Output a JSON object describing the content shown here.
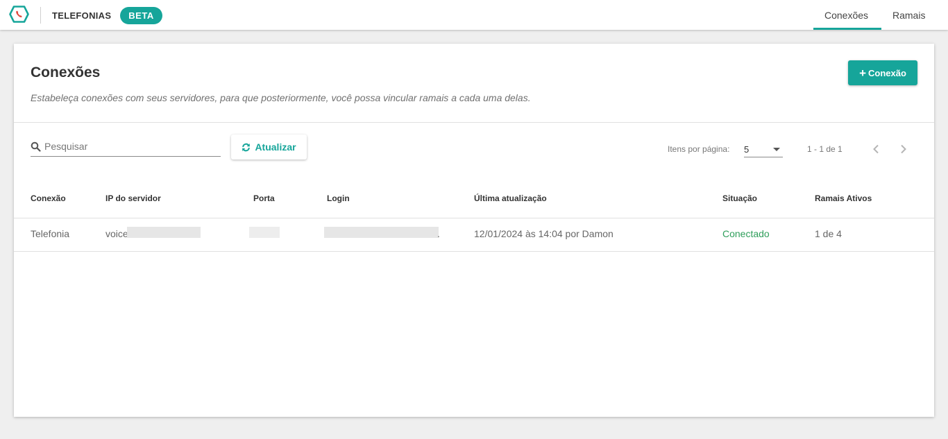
{
  "header": {
    "app_name": "TELEFONIAS",
    "badge": "BETA",
    "nav": [
      {
        "label": "Conexões",
        "active": true
      },
      {
        "label": "Ramais",
        "active": false
      }
    ],
    "logo_icon": "phone-hexagon-icon"
  },
  "page": {
    "title": "Conexões",
    "description": "Estabeleça conexões com seus servidores, para que posteriormente, você possa vincular ramais a cada uma delas.",
    "add_button": {
      "icon": "plus-icon",
      "label": "Conexão"
    }
  },
  "toolbar": {
    "search_placeholder": "Pesquisar",
    "search_icon": "search-icon",
    "refresh_label": "Atualizar",
    "refresh_icon": "refresh-icon"
  },
  "pagination": {
    "per_page_label": "Itens por página:",
    "per_page_value": "5",
    "range": "1 - 1 de 1"
  },
  "table": {
    "columns": [
      "Conexão",
      "IP do servidor",
      "Porta",
      "Login",
      "Última atualização",
      "Situação",
      "Ramais Ativos"
    ],
    "rows": [
      {
        "conexao": "Telefonia",
        "ip": "voice",
        "porta": "",
        "login": ".",
        "ultima_atualizacao": "12/01/2024 às 14:04 por Damon",
        "situacao": "Conectado",
        "ramais_ativos": "1 de 4"
      }
    ]
  },
  "colors": {
    "accent": "#16a59a",
    "status_ok": "#2e9e5a",
    "logo_red": "#e0453a"
  }
}
